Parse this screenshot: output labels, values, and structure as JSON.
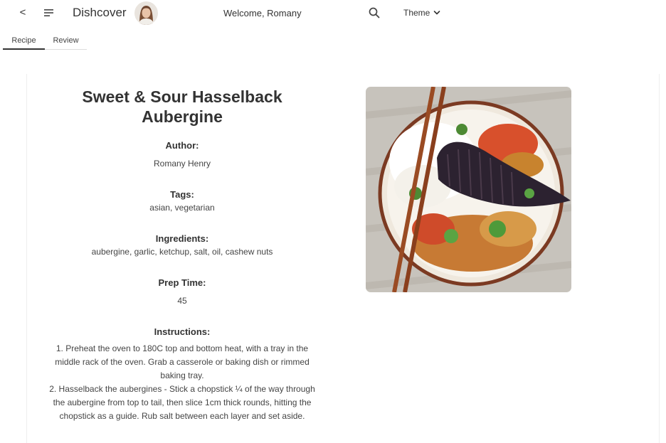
{
  "header": {
    "back_label": "<",
    "app_name": "Dishcover",
    "welcome": "Welcome, Romany",
    "theme_label": "Theme"
  },
  "tabs": [
    {
      "label": "Recipe",
      "active": true
    },
    {
      "label": "Review",
      "active": false
    }
  ],
  "recipe": {
    "title": "Sweet & Sour Hasselback Aubergine",
    "author_heading": "Author:",
    "author": "Romany Henry",
    "tags_heading": "Tags:",
    "tags": "asian, vegetarian",
    "ingredients_heading": "Ingredients:",
    "ingredients": "aubergine, garlic, ketchup, salt, oil, cashew nuts",
    "prep_heading": "Prep Time:",
    "prep_time": "45",
    "instructions_heading": "Instructions:",
    "instructions": [
      "1. Preheat the oven to 180C top and bottom heat, with a tray in the middle rack of the oven. Grab a casserole or baking dish or rimmed baking tray.",
      "2. Hasselback the aubergines - Stick a chopstick ¼ of the way through the aubergine from top to tail, then slice 1cm thick rounds, hitting the chopstick as a guide. Rub salt between each layer and set aside."
    ]
  },
  "icons": {
    "back": "back-chevron-icon",
    "menu": "menu-lines-icon",
    "search": "search-icon",
    "theme_dropdown": "chevron-down-icon"
  },
  "colors": {
    "text": "#333333",
    "tab_active_underline": "#333333",
    "background": "#ffffff"
  }
}
